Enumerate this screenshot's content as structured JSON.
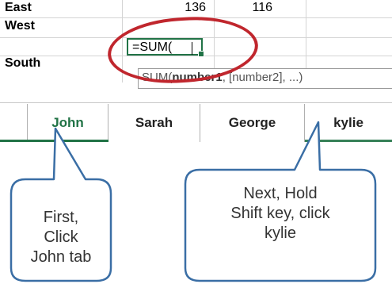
{
  "sheet": {
    "rows": [
      {
        "label": "East",
        "col2": "136",
        "col3": "116"
      },
      {
        "label": "West"
      },
      {
        "label": "South"
      }
    ],
    "formula_text": "=SUM(",
    "tooltip_fn": "SUM(",
    "tooltip_arg1": "number1",
    "tooltip_rest": ", [number2], ...)"
  },
  "tabs": [
    {
      "label": "John",
      "active": true
    },
    {
      "label": "Sarah",
      "active": false
    },
    {
      "label": "George",
      "active": false
    },
    {
      "label": "kylie",
      "active": false
    }
  ],
  "callouts": {
    "first": [
      "First,",
      "Click",
      "John tab"
    ],
    "next": [
      "Next, Hold",
      "Shift key, click",
      "kylie"
    ]
  },
  "colors": {
    "accent_green": "#217346",
    "ring_red": "#c0262d",
    "callout_border": "#3a6ea5"
  }
}
